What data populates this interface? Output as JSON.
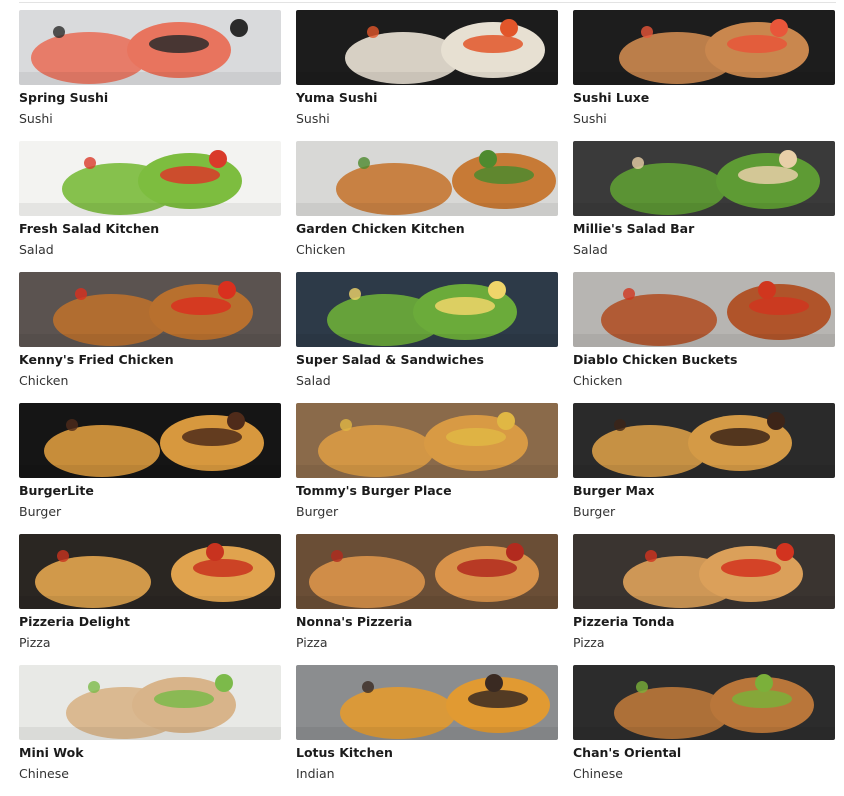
{
  "restaurants": [
    {
      "name": "Spring Sushi",
      "category": "Sushi",
      "image": "sushi-plate-image",
      "bg": "#d9dadc",
      "food": "#e8745e",
      "accent": "#2b2b2b"
    },
    {
      "name": "Yuma Sushi",
      "category": "Sushi",
      "image": "sushi-rolls-image",
      "bg": "#1c1c1c",
      "food": "#e7e0d2",
      "accent": "#e2562a"
    },
    {
      "name": "Sushi Luxe",
      "category": "Sushi",
      "image": "sushi-board-image",
      "bg": "#1d1d1d",
      "food": "#c9874e",
      "accent": "#e8563a"
    },
    {
      "name": "Fresh Salad Kitchen",
      "category": "Salad",
      "image": "salad-bowl-image",
      "bg": "#f3f3f1",
      "food": "#7dbd3f",
      "accent": "#d93a2a"
    },
    {
      "name": "Garden Chicken Kitchen",
      "category": "Chicken",
      "image": "fried-chicken-image",
      "bg": "#d8d8d6",
      "food": "#c77a36",
      "accent": "#4e8a2e"
    },
    {
      "name": "Millie's Salad Bar",
      "category": "Salad",
      "image": "chicken-salad-image",
      "bg": "#3a3a3a",
      "food": "#5e9b34",
      "accent": "#e8cfa8"
    },
    {
      "name": "Kenny's Fried Chicken",
      "category": "Chicken",
      "image": "fried-chicken-fries-image",
      "bg": "#5b5350",
      "food": "#b8702e",
      "accent": "#d9301e"
    },
    {
      "name": "Super Salad & Sandwiches",
      "category": "Salad",
      "image": "egg-salad-image",
      "bg": "#2d3a48",
      "food": "#6bab3a",
      "accent": "#f0d56a"
    },
    {
      "name": "Diablo Chicken Buckets",
      "category": "Chicken",
      "image": "chicken-wings-image",
      "bg": "#b7b5b2",
      "food": "#b0542a",
      "accent": "#d0361e"
    },
    {
      "name": "BurgerLite",
      "category": "Burger",
      "image": "two-burgers-image",
      "bg": "#151515",
      "food": "#d7983e",
      "accent": "#4f2b1a"
    },
    {
      "name": "Tommy's Burger Place",
      "category": "Burger",
      "image": "burger-fries-image",
      "bg": "#8a6a4a",
      "food": "#d89a44",
      "accent": "#e0b744"
    },
    {
      "name": "Burger Max",
      "category": "Burger",
      "image": "burgers-dark-image",
      "bg": "#2a2a2a",
      "food": "#d49a46",
      "accent": "#3c2418"
    },
    {
      "name": "Pizzeria Delight",
      "category": "Pizza",
      "image": "vegetable-pizza-image",
      "bg": "#2a2622",
      "food": "#e0a34e",
      "accent": "#c8331f"
    },
    {
      "name": "Nonna's Pizzeria",
      "category": "Pizza",
      "image": "salami-pizza-image",
      "bg": "#6a4e36",
      "food": "#d9934a",
      "accent": "#b22a1e"
    },
    {
      "name": "Pizzeria Tonda",
      "category": "Pizza",
      "image": "margherita-pizza-image",
      "bg": "#3a3430",
      "food": "#dba05a",
      "accent": "#d2331f"
    },
    {
      "name": "Mini Wok",
      "category": "Chinese",
      "image": "stir-fry-noodles-image",
      "bg": "#e8e9e6",
      "food": "#d8b48a",
      "accent": "#7cba4a"
    },
    {
      "name": "Lotus Kitchen",
      "category": "Indian",
      "image": "curry-pot-image",
      "bg": "#8b8d8f",
      "food": "#e19a32",
      "accent": "#3a2a22"
    },
    {
      "name": "Chan's Oriental",
      "category": "Chinese",
      "image": "noodles-bowl-image",
      "bg": "#2c2c2c",
      "food": "#b9763a",
      "accent": "#7bb03a"
    }
  ]
}
